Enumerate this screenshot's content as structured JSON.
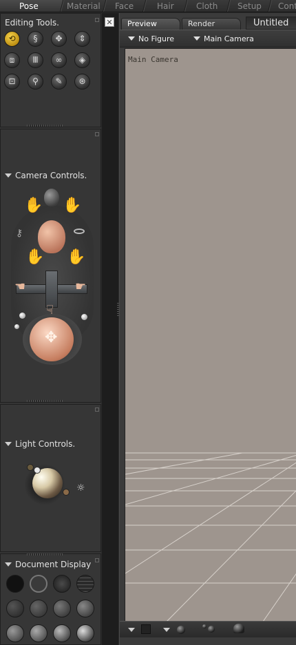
{
  "tabs": [
    {
      "label": "Pose",
      "active": true
    },
    {
      "label": "Material",
      "active": false
    },
    {
      "label": "Face",
      "active": false
    },
    {
      "label": "Hair",
      "active": false
    },
    {
      "label": "Cloth",
      "active": false
    },
    {
      "label": "Setup",
      "active": false
    },
    {
      "label": "Conte",
      "active": false
    }
  ],
  "editing_tools": {
    "title": "Editing Tools.",
    "tools": [
      {
        "icon": "rotate-icon",
        "selected": true
      },
      {
        "icon": "twist-icon"
      },
      {
        "icon": "translate-icon"
      },
      {
        "icon": "translate-in-out-icon"
      },
      {
        "icon": "scale-icon"
      },
      {
        "icon": "taper-icon"
      },
      {
        "icon": "chain-break-icon"
      },
      {
        "icon": "color-icon"
      },
      {
        "icon": "grouping-icon"
      },
      {
        "icon": "view-magnifier-icon"
      },
      {
        "icon": "morphing-tool-icon"
      },
      {
        "icon": "direct-manipulation-icon"
      }
    ]
  },
  "camera_controls": {
    "title": "Camera Controls."
  },
  "light_controls": {
    "title": "Light Controls."
  },
  "document_display": {
    "title": "Document Display"
  },
  "document": {
    "tabs": [
      {
        "label": "Preview",
        "active": true
      },
      {
        "label": "Render",
        "active": false
      }
    ],
    "title": "Untitled",
    "figure_select": "No Figure",
    "camera_select": "Main Camera",
    "viewport_label": "Main Camera"
  },
  "colors": {
    "viewport_bg": "#9e958e",
    "panel_bg": "#363636",
    "tool_selected": "#e0b22a"
  }
}
